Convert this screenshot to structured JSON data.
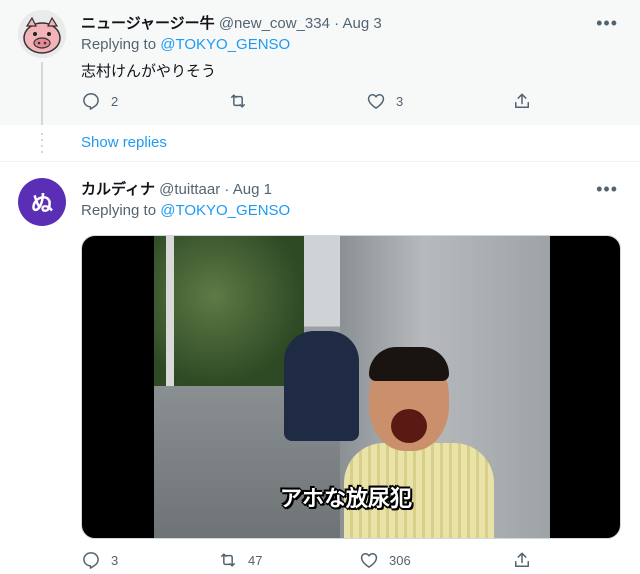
{
  "tweets": [
    {
      "name": "ニュージャージー牛",
      "handle": "@new_cow_334",
      "date": "Aug 3",
      "replying_label": "Replying to",
      "replying_to": "@TOKYO_GENSO",
      "text": "志村けんがやりそう",
      "more": "•••",
      "replies": "2",
      "retweets": "",
      "likes": "3"
    },
    {
      "name": "カルディナ",
      "handle": "@tuittaar",
      "date": "Aug 1",
      "replying_label": "Replying to",
      "replying_to": "@TOKYO_GENSO",
      "avatar_letter": "ぬ",
      "media_caption": "アホな放尿犯",
      "more": "•••",
      "replies": "3",
      "retweets": "47",
      "likes": "306"
    }
  ],
  "show_replies": "Show replies",
  "separator": "·",
  "colors": {
    "accent": "#1d9bf0",
    "muted": "#536471",
    "avatar2_bg": "#5b2fb5"
  }
}
